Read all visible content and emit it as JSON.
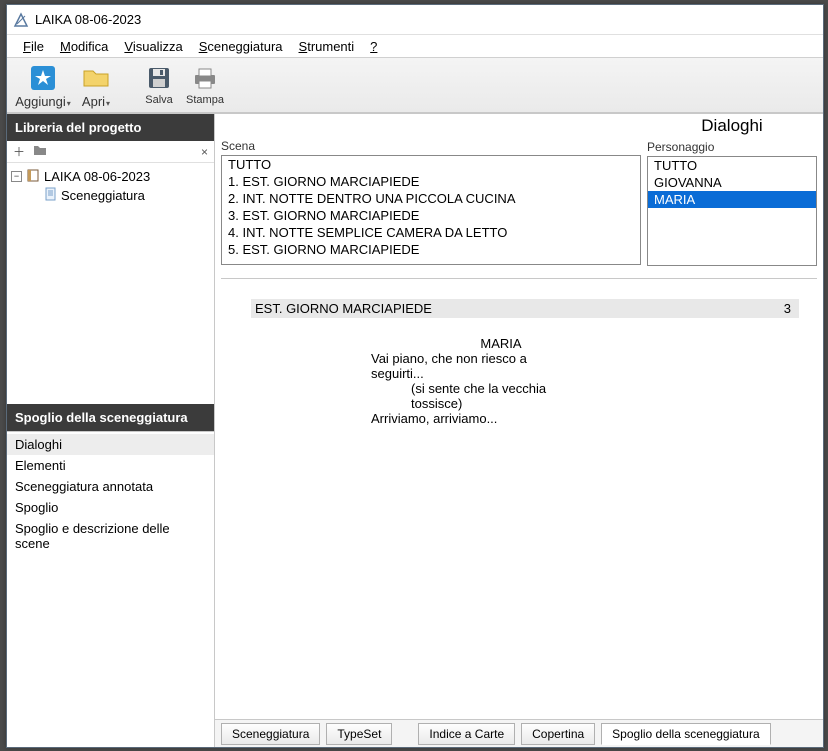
{
  "title": "LAIKA 08-06-2023",
  "menu": [
    "File",
    "Modifica",
    "Visualizza",
    "Sceneggiatura",
    "Strumenti",
    "?"
  ],
  "toolbar": {
    "aggiungi": "Aggiungi",
    "apri": "Apri",
    "salva": "Salva",
    "stampa": "Stampa"
  },
  "library": {
    "header": "Libreria del progetto",
    "root": "LAIKA 08-06-2023",
    "child": "Sceneggiatura"
  },
  "spoglio": {
    "header": "Spoglio della sceneggiatura",
    "items": [
      "Dialoghi",
      "Elementi",
      "Sceneggiatura annotata",
      "Spoglio",
      "Spoglio e descrizione delle scene"
    ],
    "selected": 0
  },
  "scena": {
    "label": "Scena",
    "items": [
      "TUTTO",
      "1. EST. GIORNO MARCIAPIEDE",
      "2. INT. NOTTE DENTRO UNA PICCOLA CUCINA",
      "3. EST. GIORNO MARCIAPIEDE",
      "4. INT. NOTTE SEMPLICE CAMERA DA LETTO",
      "5. EST. GIORNO MARCIAPIEDE"
    ]
  },
  "dialoghi": {
    "title": "Dialoghi",
    "label": "Personaggio",
    "items": [
      "TUTTO",
      "GIOVANNA",
      "MARIA"
    ],
    "selected": 2
  },
  "script": {
    "heading": "EST. GIORNO MARCIAPIEDE",
    "scene_num": "3",
    "character": "MARIA",
    "line1": "Vai piano, che non riesco a",
    "line2": "seguirti...",
    "paren1": "(si sente che la vecchia",
    "paren2": "tossisce)",
    "line3": "Arriviamo, arriviamo..."
  },
  "tabs": [
    "Sceneggiatura",
    "TypeSet",
    "Indice a Carte",
    "Copertina",
    "Spoglio della sceneggiatura"
  ],
  "active_tab": 4
}
